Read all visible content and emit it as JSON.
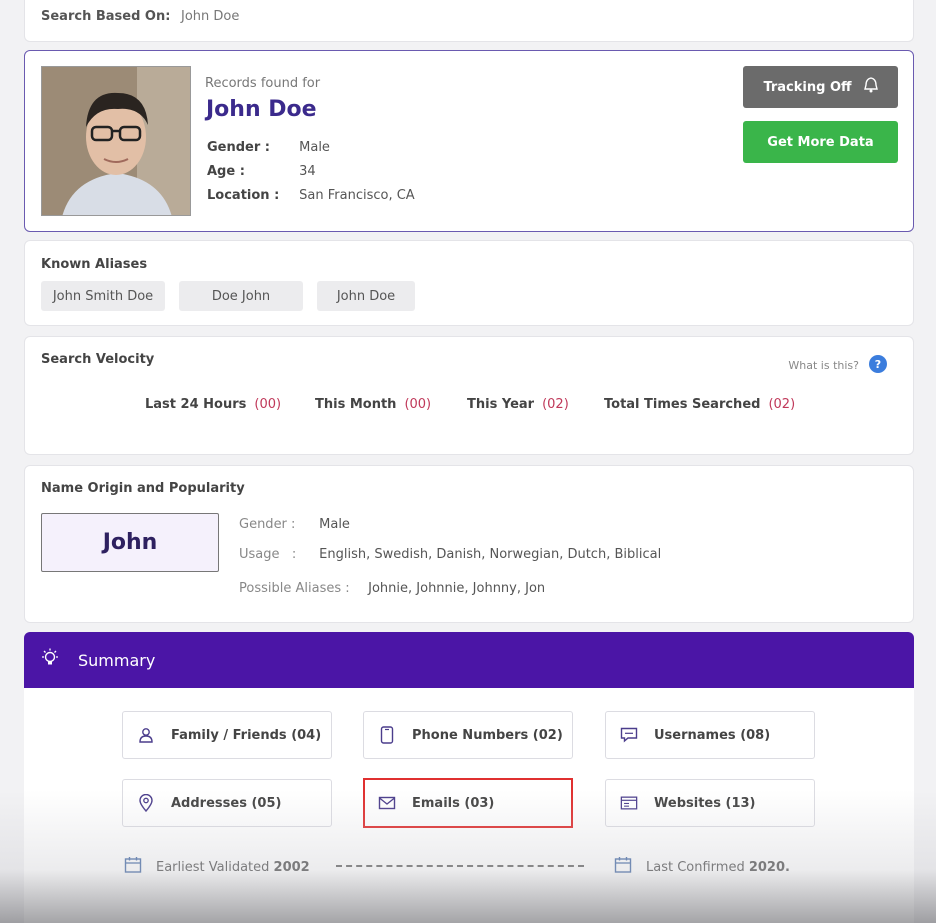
{
  "search": {
    "label": "Search Based On:",
    "value": "John Doe"
  },
  "profile": {
    "records_label": "Records found for",
    "name": "John Doe",
    "gender_label": "Gender :",
    "gender": "Male",
    "age_label": "Age :",
    "age": "34",
    "location_label": "Location :",
    "location": "San Francisco, CA",
    "tracking_label": "Tracking Off",
    "more_label": "Get More Data"
  },
  "aliases": {
    "title": "Known Aliases",
    "items": [
      "John Smith Doe",
      "Doe John",
      "John Doe"
    ]
  },
  "velocity": {
    "title": "Search Velocity",
    "what_is": "What is this?",
    "items": [
      {
        "label": "Last 24 Hours",
        "count": "(00)"
      },
      {
        "label": "This Month",
        "count": "(00)"
      },
      {
        "label": "This Year",
        "count": "(02)"
      },
      {
        "label": "Total Times Searched",
        "count": "(02)"
      }
    ]
  },
  "origin": {
    "title": "Name Origin and Popularity",
    "first_name": "John",
    "gender_label": "Gender :",
    "gender": "Male",
    "usage_label": "Usage   :",
    "usage": "English, Swedish, Danish, Norwegian, Dutch, Biblical",
    "aliases_label": "Possible Aliases :",
    "aliases": "Johnie, Johnnie, Johnny, Jon"
  },
  "summary": {
    "title": "Summary",
    "buttons": [
      {
        "label": "Family / Friends",
        "count": "(04)",
        "icon": "person-icon"
      },
      {
        "label": "Phone Numbers",
        "count": "(02)",
        "icon": "phone-icon"
      },
      {
        "label": "Usernames",
        "count": "(08)",
        "icon": "chat-icon"
      },
      {
        "label": "Addresses",
        "count": "(05)",
        "icon": "location-pin-icon"
      },
      {
        "label": "Emails",
        "count": "(03)",
        "icon": "envelope-icon"
      },
      {
        "label": "Websites",
        "count": "(13)",
        "icon": "website-icon"
      }
    ],
    "earliest_label": "Earliest Validated",
    "earliest_year": "2002",
    "confirmed_label": "Last Confirmed",
    "confirmed_year": "2020."
  },
  "colors": {
    "brand": "#4b15a6",
    "green": "#3ab54a",
    "highlight": "#e03030",
    "count": "#c0395a"
  }
}
